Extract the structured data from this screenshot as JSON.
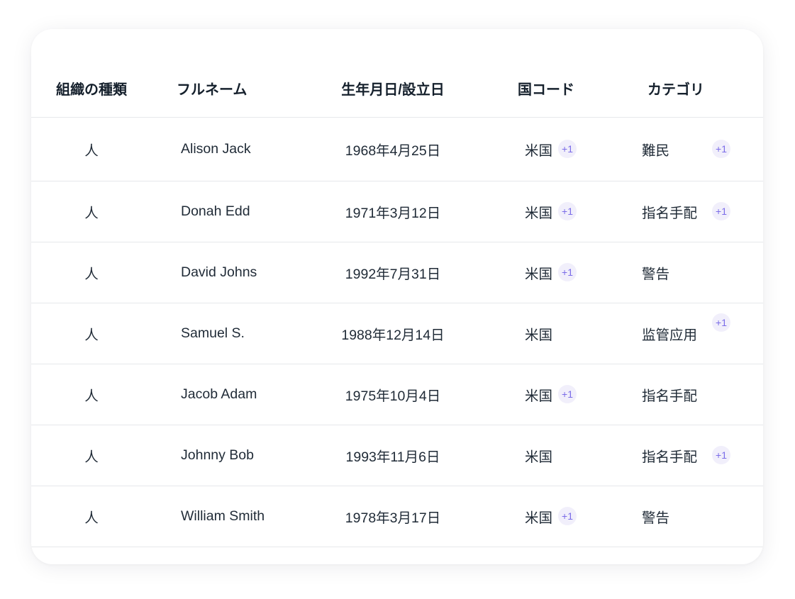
{
  "headers": {
    "type": "組織の種類",
    "name": "フルネーム",
    "dob": "生年月日/設立日",
    "country": "国コード",
    "category": "カテゴリ"
  },
  "rows": [
    {
      "type": "人",
      "name": "Alison Jack",
      "dob": "1968年4月25日",
      "country": "米国",
      "country_badge": "+1",
      "category": "難民",
      "category_badge": "+1",
      "category_badge_raised": false
    },
    {
      "type": "人",
      "name": "Donah Edd",
      "dob": "1971年3月12日",
      "country": "米国",
      "country_badge": "+1",
      "category": "指名手配",
      "category_badge": "+1",
      "category_badge_raised": false
    },
    {
      "type": "人",
      "name": "David Johns",
      "dob": "1992年7月31日",
      "country": "米国",
      "country_badge": "+1",
      "category": "警告",
      "category_badge": null,
      "category_badge_raised": false
    },
    {
      "type": "人",
      "name": "Samuel S.",
      "dob": "1988年12月14日",
      "country": "米国",
      "country_badge": null,
      "category": "监管应用",
      "category_badge": "+1",
      "category_badge_raised": true
    },
    {
      "type": "人",
      "name": "Jacob Adam",
      "dob": "1975年10月4日",
      "country": "米国",
      "country_badge": "+1",
      "category": "指名手配",
      "category_badge": null,
      "category_badge_raised": false
    },
    {
      "type": "人",
      "name": "Johnny Bob",
      "dob": "1993年11月6日",
      "country": "米国",
      "country_badge": null,
      "category": "指名手配",
      "category_badge": "+1",
      "category_badge_raised": false
    },
    {
      "type": "人",
      "name": "William Smith",
      "dob": "1978年3月17日",
      "country": "米国",
      "country_badge": "+1",
      "category": "警告",
      "category_badge": null,
      "category_badge_raised": false
    }
  ],
  "colors": {
    "badge_text": "#7b6ce8",
    "badge_bg": "#f1effb",
    "divider": "#e6e8eb"
  }
}
